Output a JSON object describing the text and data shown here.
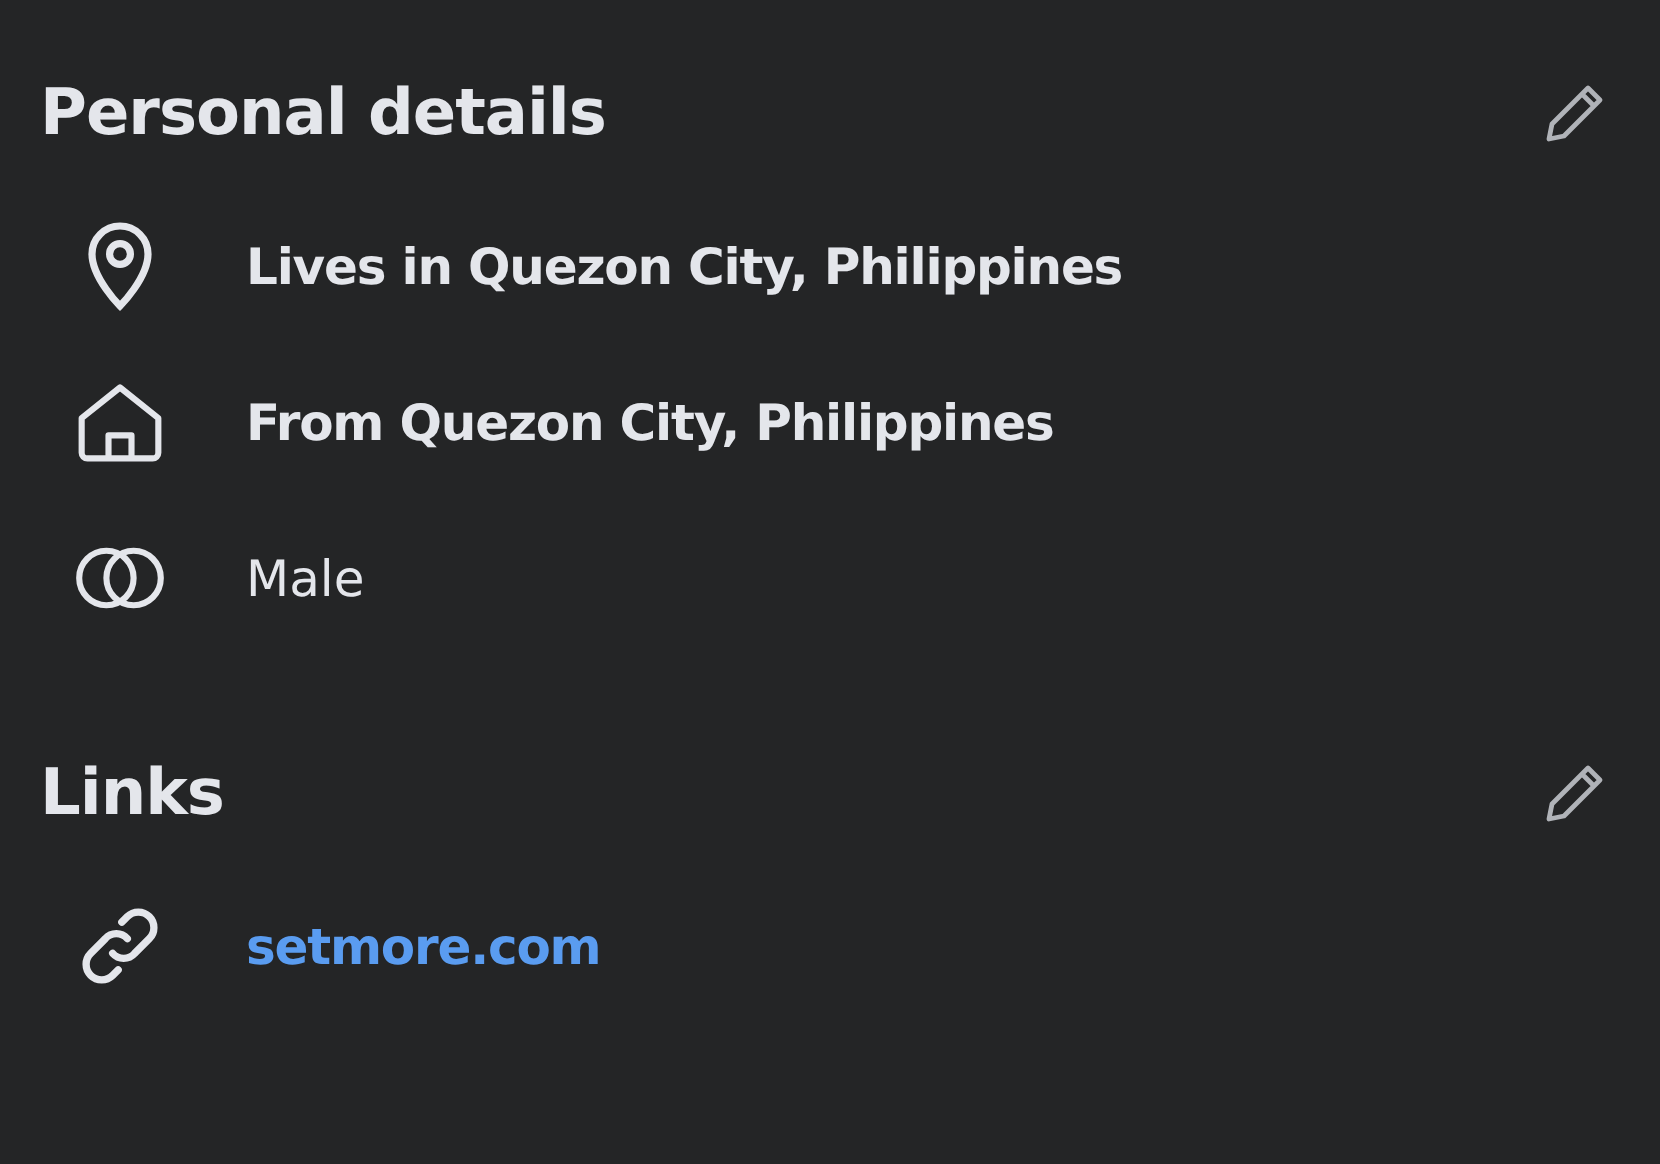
{
  "sections": [
    {
      "title": "Personal details",
      "items": [
        {
          "kind": "location",
          "text": "Lives in Quezon City, Philippines",
          "bold": true
        },
        {
          "kind": "home",
          "text": "From Quezon City, Philippines",
          "bold": true
        },
        {
          "kind": "gender",
          "text": "Male",
          "bold": false
        }
      ]
    },
    {
      "title": "Links",
      "items": [
        {
          "kind": "link",
          "text": "setmore.com",
          "bold": true
        }
      ]
    }
  ]
}
